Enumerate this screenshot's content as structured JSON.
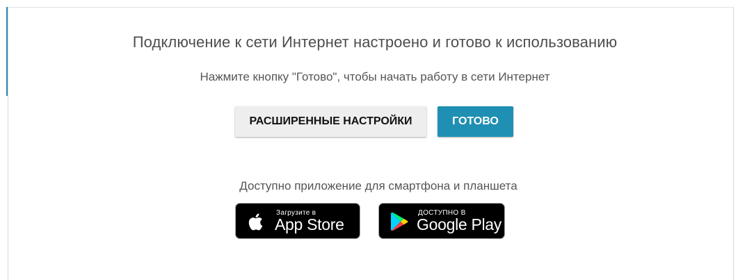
{
  "main": {
    "heading": "Подключение к сети Интернет настроено и готово к использованию",
    "subtext": "Нажмите кнопку \"Готово\", чтобы начать работу в сети Интернет",
    "advanced_button_label": "РАСШИРЕННЫЕ НАСТРОЙКИ",
    "done_button_label": "ГОТОВО"
  },
  "apps": {
    "label": "Доступно приложение для смартфона и планшета",
    "app_store": {
      "small_text": "Загрузите в",
      "big_text": "App Store",
      "icon": "apple-icon"
    },
    "google_play": {
      "small_text": "ДОСТУПНО В",
      "big_text": "Google Play",
      "icon": "google-play-icon"
    }
  },
  "colors": {
    "accent": "#1f8fb3",
    "heading_text": "#4d4d4d",
    "secondary_button_bg": "#eeeeee"
  }
}
